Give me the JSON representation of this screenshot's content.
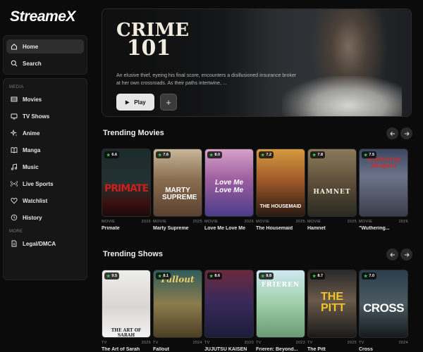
{
  "app": {
    "logo": "StreameX"
  },
  "sidebar": {
    "top_items": [
      {
        "label": "Home",
        "icon": "home-icon",
        "active": true
      },
      {
        "label": "Search",
        "icon": "search-icon",
        "active": false
      }
    ],
    "media_label": "MEDIA",
    "media_items": [
      {
        "label": "Movies",
        "icon": "film-icon"
      },
      {
        "label": "TV Shows",
        "icon": "tv-icon"
      },
      {
        "label": "Anime",
        "icon": "sparkles-icon"
      },
      {
        "label": "Manga",
        "icon": "book-icon"
      },
      {
        "label": "Music",
        "icon": "music-icon"
      },
      {
        "label": "Live Sports",
        "icon": "broadcast-icon"
      },
      {
        "label": "Watchlist",
        "icon": "heart-icon"
      },
      {
        "label": "History",
        "icon": "history-icon"
      }
    ],
    "more_label": "MORE",
    "more_items": [
      {
        "label": "Legal/DMCA",
        "icon": "document-icon"
      }
    ]
  },
  "hero": {
    "title_line1": "CRIME",
    "title_line2": "101",
    "description": "An elusive thief, eyeing his final score, encounters a disillusioned insurance broker at her own crossroads. As their paths intertwine, ...",
    "play_label": "Play",
    "add_label": "+"
  },
  "trending_movies": {
    "title": "Trending Movies",
    "items": [
      {
        "title": "Primate",
        "type": "MOVIE",
        "year": "2026",
        "rating": "6.6",
        "poster_text": "PRIMATE"
      },
      {
        "title": "Marty Supreme",
        "type": "MOVIE",
        "year": "2025",
        "rating": "7.6",
        "poster_text": "MARTY SUPREME"
      },
      {
        "title": "Love Me Love Me",
        "type": "MOVIE",
        "year": "2026",
        "rating": "8.0",
        "poster_text": "Love Me Love Me"
      },
      {
        "title": "The Housemaid",
        "type": "MOVIE",
        "year": "2025",
        "rating": "7.2",
        "poster_text": "THE HOUSEMAID"
      },
      {
        "title": "Hamnet",
        "type": "MOVIE",
        "year": "2025",
        "rating": "7.8",
        "poster_text": "HAMNET"
      },
      {
        "title": "\"Wuthering...",
        "type": "MOVIE",
        "year": "2026",
        "rating": "7.5",
        "poster_text": "Wuthering Heights"
      }
    ]
  },
  "trending_shows": {
    "title": "Trending Shows",
    "items": [
      {
        "title": "The Art of Sarah",
        "type": "TV",
        "year": "2026",
        "rating": "9.5",
        "poster_text": "THE ART OF SARAH"
      },
      {
        "title": "Fallout",
        "type": "TV",
        "year": "2024",
        "rating": "8.1",
        "poster_text": "Fallout"
      },
      {
        "title": "JUJUTSU KAISEN",
        "type": "TV",
        "year": "2020",
        "rating": "8.6",
        "poster_text": ""
      },
      {
        "title": "Frieren: Beyond...",
        "type": "TV",
        "year": "2023",
        "rating": "8.8",
        "poster_text": "FRIEREN"
      },
      {
        "title": "The Pitt",
        "type": "TV",
        "year": "2025",
        "rating": "8.7",
        "poster_text": "THE PITT"
      },
      {
        "title": "Cross",
        "type": "TV",
        "year": "2024",
        "rating": "7.0",
        "poster_text": "CROSS"
      }
    ]
  },
  "colors": {
    "rating_star": "#3fd25b",
    "background": "#0b0b0b",
    "panel": "#161616"
  }
}
